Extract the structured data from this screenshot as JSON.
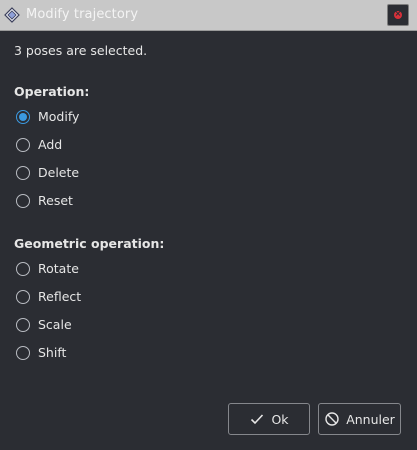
{
  "window": {
    "title": "Modify trajectory",
    "close_icon": "close-icon"
  },
  "info_text": "3 poses are selected.",
  "operation": {
    "title": "Operation:",
    "options": [
      {
        "label": "Modify",
        "checked": true
      },
      {
        "label": "Add",
        "checked": false
      },
      {
        "label": "Delete",
        "checked": false
      },
      {
        "label": "Reset",
        "checked": false
      }
    ]
  },
  "geometric": {
    "title": "Geometric operation:",
    "options": [
      {
        "label": "Rotate",
        "checked": false
      },
      {
        "label": "Reflect",
        "checked": false
      },
      {
        "label": "Scale",
        "checked": false
      },
      {
        "label": "Shift",
        "checked": false
      }
    ]
  },
  "buttons": {
    "ok_label": "Ok",
    "ok_icon": "check-icon",
    "cancel_label": "Annuler",
    "cancel_icon": "cancel-icon"
  },
  "colors": {
    "background": "#2b2d33",
    "titlebar": "#c8c8c8",
    "accent": "#3b9ae1",
    "close": "#d9303a"
  }
}
